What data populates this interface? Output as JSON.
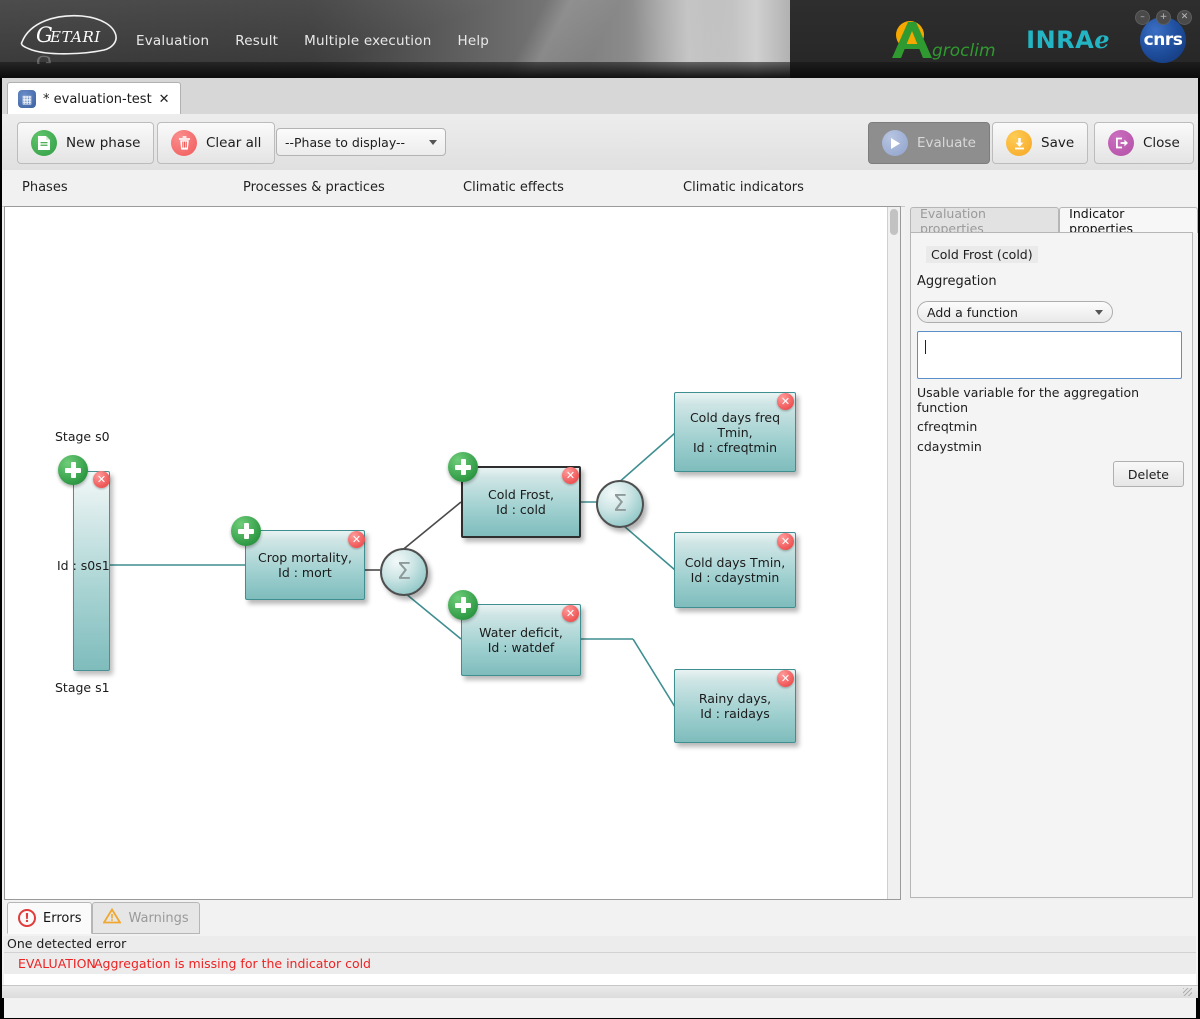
{
  "window": {
    "controls": [
      {
        "name": "minimize-button",
        "glyph": "–"
      },
      {
        "name": "maximize-button",
        "glyph": "+"
      },
      {
        "name": "close-button",
        "glyph": "✕"
      }
    ]
  },
  "header": {
    "logo_text": "GETARI",
    "menu": [
      {
        "label": "Evaluation"
      },
      {
        "label": "Result"
      },
      {
        "label": "Multiple execution"
      },
      {
        "label": "Help"
      }
    ],
    "brands": [
      {
        "name": "agroclim-logo",
        "label": "Agroclim"
      },
      {
        "name": "inrae-logo",
        "label": "INRAℯ"
      },
      {
        "name": "cnrs-logo",
        "label": "cnrs"
      }
    ]
  },
  "tab": {
    "label": "* evaluation-test",
    "close_glyph": "✕",
    "icon": "grid-icon"
  },
  "toolbar": {
    "new_phase": "New phase",
    "clear_all": "Clear all",
    "phase_select_value": "--Phase to display--",
    "evaluate": "Evaluate",
    "save": "Save",
    "close": "Close"
  },
  "columns": [
    {
      "label": "Phases"
    },
    {
      "label": "Processes & practices"
    },
    {
      "label": "Climatic effects"
    },
    {
      "label": "Climatic indicators"
    }
  ],
  "graph": {
    "stage_top": "Stage s0",
    "stage_bottom": "Stage s1",
    "phase_id": "Id : s0s1",
    "nodes": [
      {
        "name": "node-crop-mortality",
        "title": "Crop mortality,",
        "id_line": "Id : mort",
        "selected": false
      },
      {
        "name": "node-cold-frost",
        "title": "Cold Frost,",
        "id_line": "Id : cold",
        "selected": true
      },
      {
        "name": "node-water-deficit",
        "title": "Water deficit,",
        "id_line": "Id : watdef",
        "selected": false
      },
      {
        "name": "node-cold-days-freq-tmin",
        "title": "Cold days freq",
        "title2": "Tmin,",
        "id_line": "Id : cfreqtmin",
        "selected": false
      },
      {
        "name": "node-cold-days-tmin",
        "title": "Cold days Tmin,",
        "id_line": "Id : cdaystmin",
        "selected": false
      },
      {
        "name": "node-rainy-days",
        "title": "Rainy days,",
        "id_line": "Id : raidays",
        "selected": false
      }
    ],
    "aggregator_glyph": "Σ",
    "delete_glyph": "✕"
  },
  "properties": {
    "tab_evaluation": "Evaluation properties",
    "tab_indicator": "Indicator properties",
    "indicator_name": "Cold Frost (cold)",
    "section_label": "Aggregation",
    "function_select_value": "Add a function",
    "formula_value": "",
    "help_text": "Usable variable for the aggregation function",
    "variables": [
      "cfreqtmin",
      "cdaystmin"
    ],
    "delete_button": "Delete"
  },
  "bottom": {
    "tab_errors": "Errors",
    "tab_warnings": "Warnings",
    "summary": "One detected error",
    "errors": [
      {
        "tag": "EVALUATION",
        "message": "Aggregation is missing for the indicator cold"
      }
    ]
  },
  "colors": {
    "error_red": "#ee2222",
    "node_border": "#3f8e90",
    "accent_green": "#2f9a45",
    "inrae_teal": "#23b5c4"
  }
}
